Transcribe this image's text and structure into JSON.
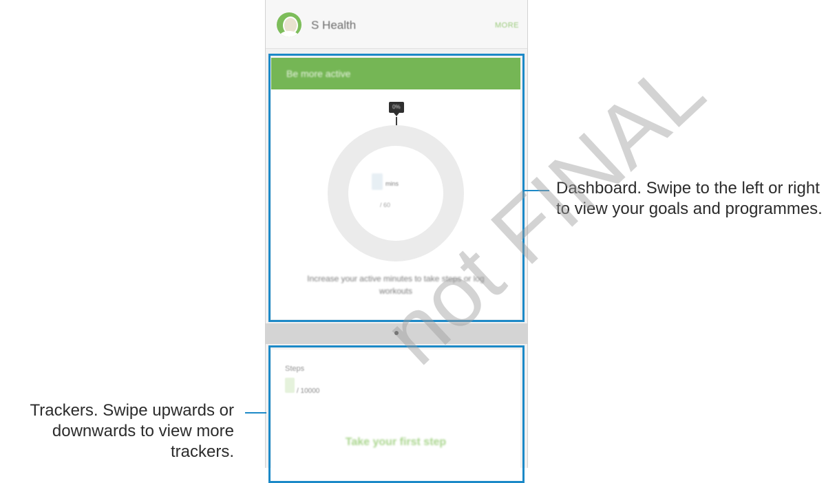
{
  "header": {
    "title": "S Health",
    "more_label": "MORE",
    "avatar_icon": "profile-avatar-icon"
  },
  "dashboard": {
    "banner_title": "Be more active",
    "tooltip_value": "0%",
    "ring_unit": "mins",
    "ring_goal": "/ 60",
    "progress": 0,
    "description": "Increase your active minutes to take steps or log workouts"
  },
  "trackers": {
    "title": "Steps",
    "goal": "/ 10000",
    "cta": "Take your first step"
  },
  "callouts": {
    "dashboard": "Dashboard. Swipe to the left or right to view your goals and programmes.",
    "trackers": "Trackers. Swipe upwards or downwards to view more trackers."
  },
  "watermark": "not FINAL",
  "colors": {
    "accent_green": "#75b655",
    "highlight_blue": "#1c89c7",
    "ring_gray": "#ebebeb"
  }
}
